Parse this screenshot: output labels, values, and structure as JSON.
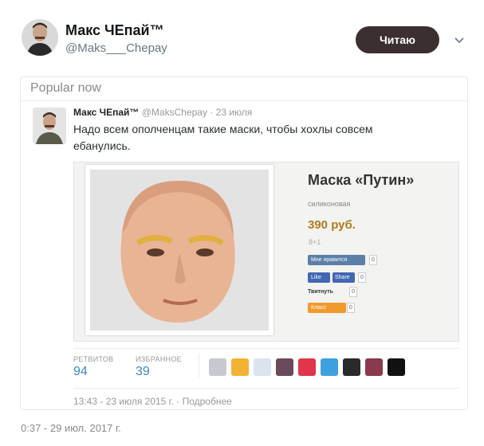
{
  "header": {
    "name": "Макс ЧЕпай™",
    "handle": "@Maks___Chepay",
    "follow_label": "Читаю"
  },
  "card": {
    "title": "Popular now",
    "tweet": {
      "name": "Макс ЧЕпай™",
      "handle": "@MaksChepay",
      "date": "· 23 июля",
      "text": "Надо всем ополченцам такие маски, чтобы хохлы совсем ебанулись.",
      "media": {
        "product_title": "Маска «Путин»",
        "product_material": "силиконовая",
        "product_price": "390 руб.",
        "plus_one": "8+1",
        "vk_label": "Мне нравится",
        "fb_like": "Like",
        "fb_share": "Share",
        "tw_label": "Твитнуть",
        "ok_label": "Класс",
        "count_zero": "0"
      },
      "stats": {
        "retweets_label": "РЕТВИТОВ",
        "retweets_value": "94",
        "likes_label": "ИЗБРАННОЕ",
        "likes_value": "39"
      },
      "timestamp": "13:43 - 23 июля 2015 г. · Подробнее"
    }
  },
  "footer": {
    "timestamp": "0:37 - 29 июл. 2017 г."
  },
  "colors": {
    "follow_button": "#3b2f2f",
    "stat_value": "#3b88c3",
    "price": "#b07c1e"
  },
  "liker_avatars": [
    "avatar-1",
    "avatar-2",
    "avatar-3",
    "avatar-4",
    "avatar-5",
    "avatar-6",
    "avatar-7",
    "avatar-8",
    "avatar-9"
  ]
}
